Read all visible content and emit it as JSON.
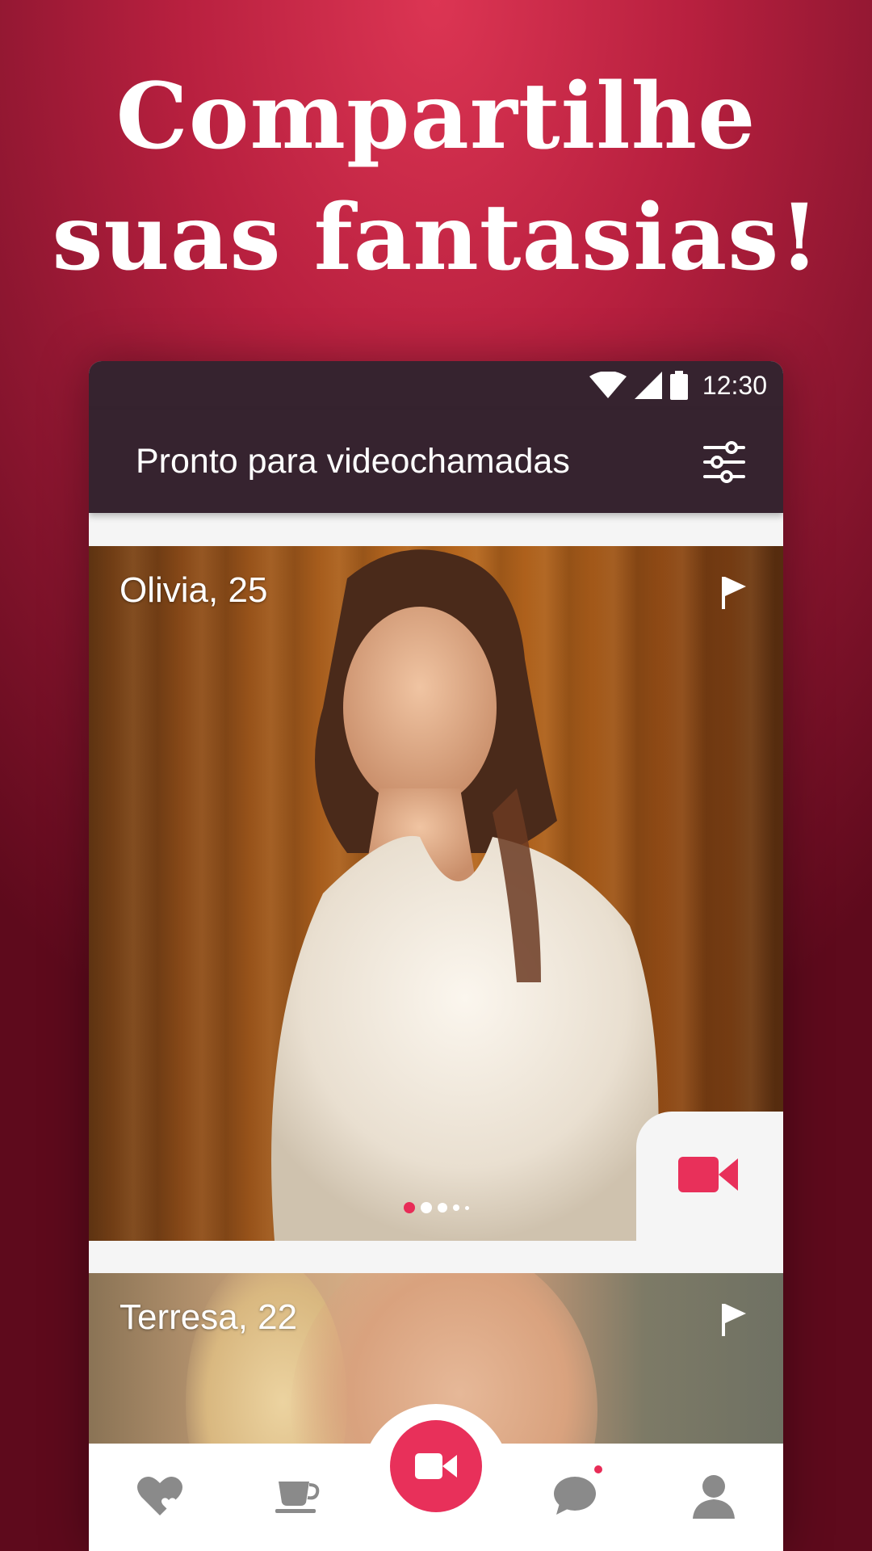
{
  "headline": {
    "line1": "Compartilhe",
    "line2": "suas fantasias!"
  },
  "status_bar": {
    "time": "12:30"
  },
  "app_bar": {
    "title": "Pronto para videochamadas",
    "filter_icon": "sliders-icon"
  },
  "profiles": [
    {
      "name_age": "Olivia, 25",
      "flag_icon": "flag-icon",
      "photo_dots": 4,
      "active_dot": 0
    },
    {
      "name_age": "Terresa, 22",
      "flag_icon": "flag-icon"
    }
  ],
  "bottom_nav": {
    "items": [
      "heart-icon",
      "coffee-cup-icon",
      "video-camera-icon",
      "chat-bubble-icon",
      "person-icon"
    ],
    "chat_has_notification": true
  },
  "colors": {
    "accent": "#e8305a",
    "appbar": "#36232f",
    "background": "#b8203f"
  }
}
